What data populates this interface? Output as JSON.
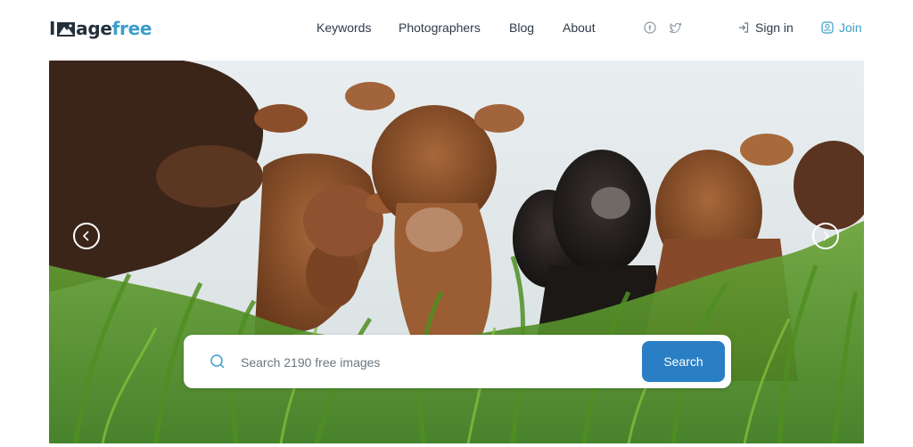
{
  "brand": {
    "logo_prefix": "I",
    "logo_mid": "age",
    "logo_suffix": "free",
    "accent": "#3a9ec9",
    "dark": "#23303c"
  },
  "nav": {
    "items": [
      "Keywords",
      "Photographers",
      "Blog",
      "About"
    ]
  },
  "social": {
    "icons": [
      "facebook-icon",
      "twitter-icon"
    ]
  },
  "auth": {
    "signin_label": "Sign in",
    "join_label": "Join"
  },
  "hero": {
    "image_subject": "herd of cows in tall green grass",
    "prev_icon": "chevron-left-icon",
    "next_icon": "chevron-right-icon"
  },
  "search": {
    "placeholder": "Search 2190 free images",
    "value": "",
    "button_label": "Search",
    "button_color": "#2a7fc4"
  }
}
